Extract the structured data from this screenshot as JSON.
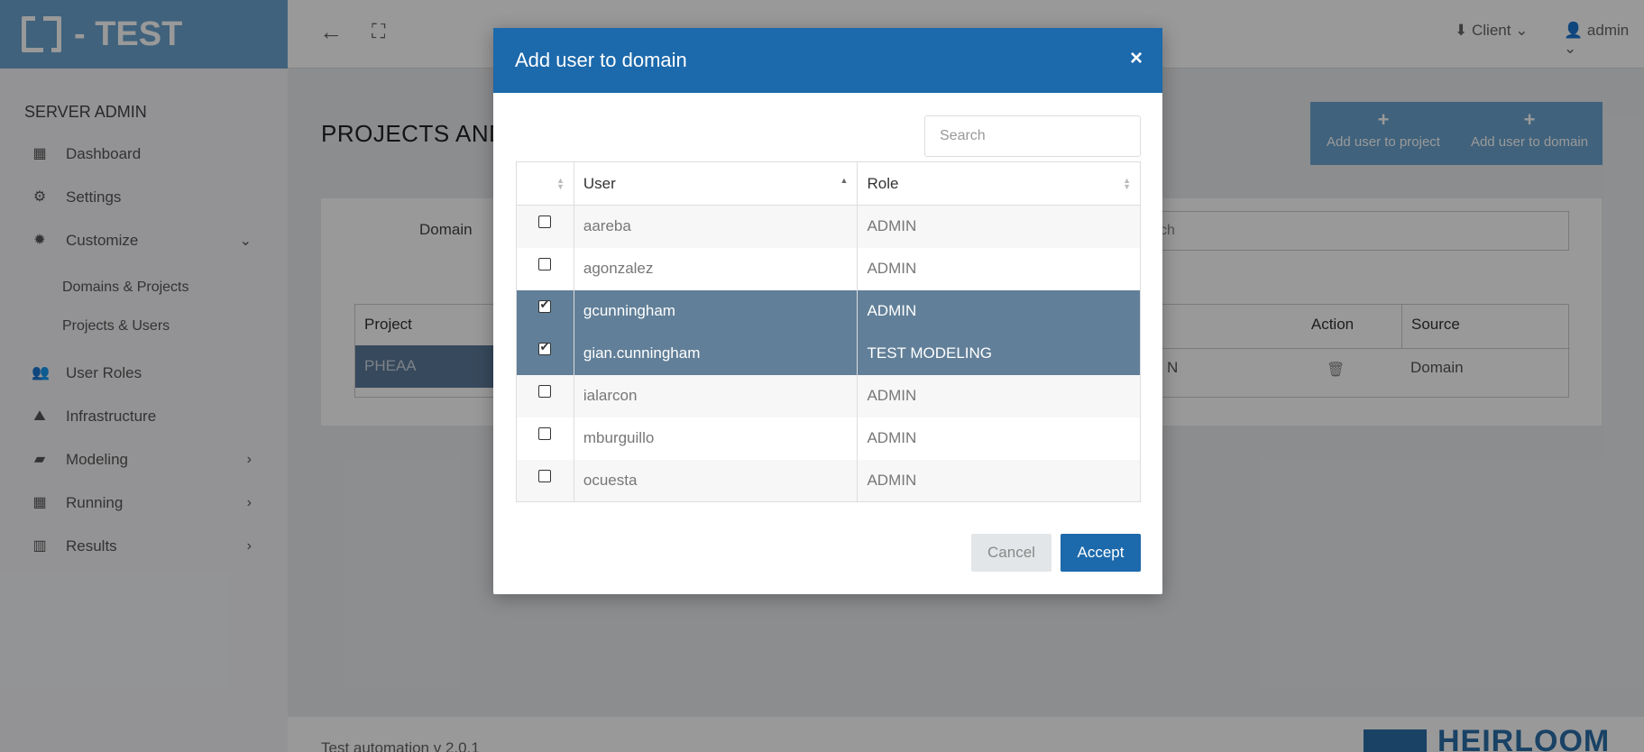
{
  "app": {
    "brand_title": "- TEST"
  },
  "sidebar": {
    "section_title": "SERVER ADMIN",
    "items": [
      {
        "label": "Dashboard",
        "icon": "dashboard-icon"
      },
      {
        "label": "Settings",
        "icon": "gear-icon"
      },
      {
        "label": "Customize",
        "icon": "sun-icon"
      },
      {
        "label": "User Roles",
        "icon": "users-icon"
      },
      {
        "label": "Infrastructure",
        "icon": "road-icon"
      },
      {
        "label": "Modeling",
        "icon": "briefcase-icon"
      },
      {
        "label": "Running",
        "icon": "calendar-icon"
      },
      {
        "label": "Results",
        "icon": "bar-chart-icon"
      }
    ],
    "subitems": [
      {
        "label": "Domains & Projects"
      },
      {
        "label": "Projects & Users"
      }
    ]
  },
  "topbar": {
    "client_label": "Client",
    "user_label": "admin"
  },
  "main": {
    "page_title": "PROJECTS AND",
    "add_user_to_project": "Add user to project",
    "add_user_to_domain": "Add user to domain",
    "domain_label": "Domain",
    "search_partial": "ch",
    "table_headers": [
      "Project",
      "Action",
      "Source"
    ],
    "row_project": "PHEAA",
    "row_partial": "N",
    "row_source": "Domain"
  },
  "footer": {
    "text": "Test automation v 2.0.1",
    "logo": "HEIRLOOM"
  },
  "modal": {
    "title": "Add user to domain",
    "close": "×",
    "search_placeholder": "Search",
    "columns": {
      "user": "User",
      "role": "Role"
    },
    "rows": [
      {
        "user": "aareba",
        "role": "ADMIN",
        "checked": false
      },
      {
        "user": "agonzalez",
        "role": "ADMIN",
        "checked": false
      },
      {
        "user": "gcunningham",
        "role": "ADMIN",
        "checked": true
      },
      {
        "user": "gian.cunningham",
        "role": "TEST MODELING",
        "checked": true
      },
      {
        "user": "ialarcon",
        "role": "ADMIN",
        "checked": false
      },
      {
        "user": "mburguillo",
        "role": "ADMIN",
        "checked": false
      },
      {
        "user": "ocuesta",
        "role": "ADMIN",
        "checked": false
      }
    ],
    "cancel_label": "Cancel",
    "accept_label": "Accept"
  },
  "colors": {
    "primary": "#1c69ab",
    "brand": "#6ba4cf",
    "selected_row": "#617f98"
  }
}
